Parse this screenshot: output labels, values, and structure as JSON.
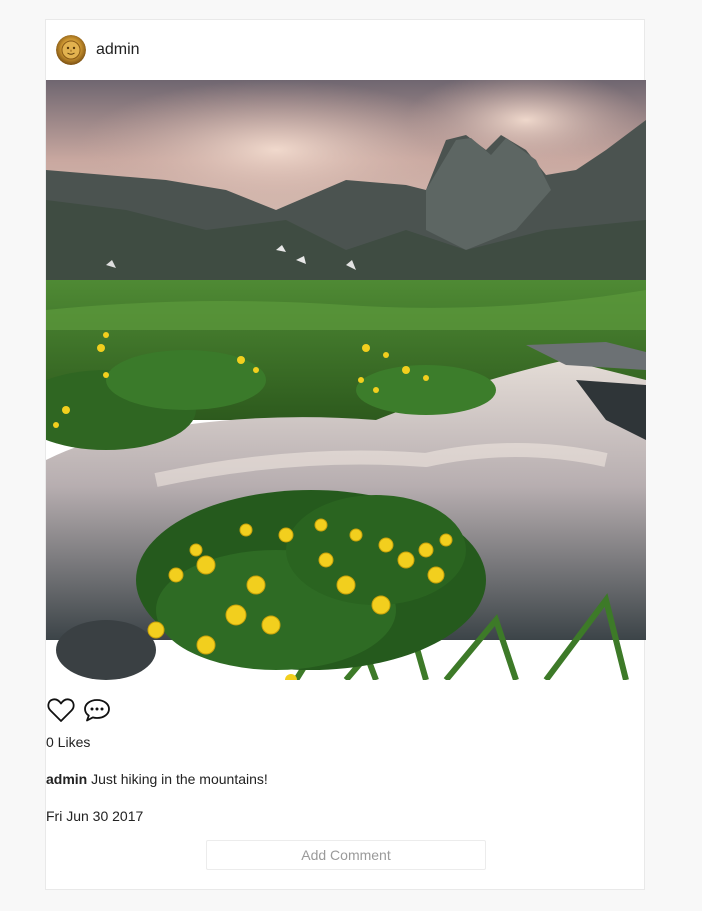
{
  "post": {
    "username": "admin",
    "avatar_icon": "golden-sun-face-icon",
    "photo_description_icon": "mountain-lake-flowers-photo",
    "likes_label": "0 Likes",
    "caption_user": "admin",
    "caption_text": "Just hiking in the mountains!",
    "date": "Fri Jun 30 2017",
    "add_comment_placeholder": "Add Comment"
  },
  "icons": {
    "like": "heart-icon",
    "comment": "speech-bubble-icon"
  },
  "colors": {
    "background": "#f8f8f8",
    "card": "#ffffff",
    "text": "#222222",
    "placeholder": "#9a9a9a"
  }
}
